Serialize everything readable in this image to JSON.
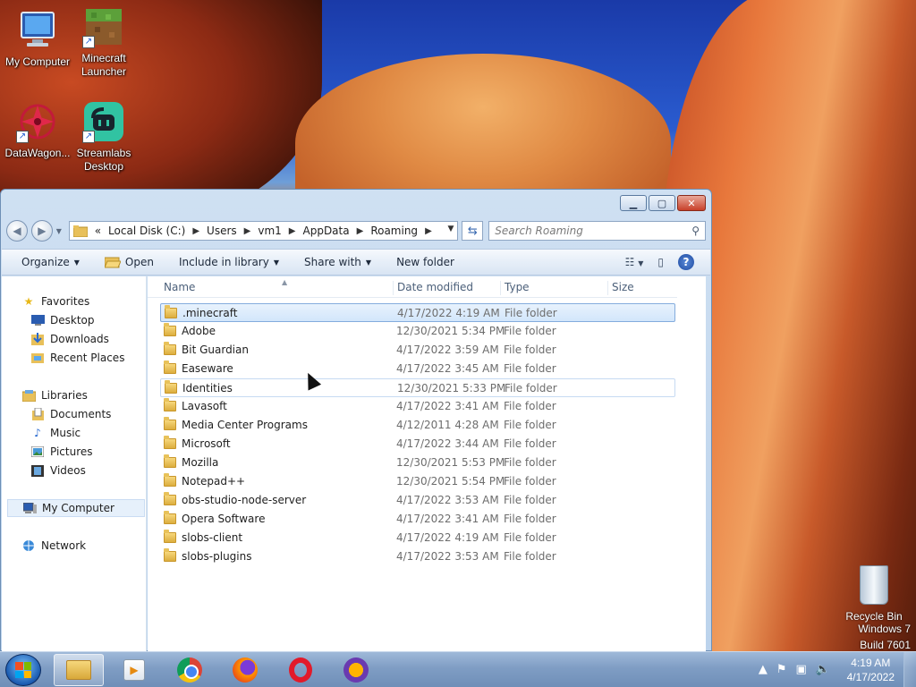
{
  "desktop": {
    "icons": [
      {
        "label": "My Computer",
        "icon": "computer-icon"
      },
      {
        "label": "Minecraft Launcher",
        "icon": "minecraft-icon"
      },
      {
        "label": "DataWagon...",
        "icon": "datawagon-icon"
      },
      {
        "label": "Streamlabs Desktop",
        "icon": "streamlabs-icon"
      }
    ],
    "recycle_bin": "Recycle Bin",
    "watermark": {
      "line1": "Windows 7",
      "line2": "Build 7601"
    }
  },
  "explorer": {
    "address": {
      "overflow": "«",
      "crumbs": [
        "Local Disk (C:)",
        "Users",
        "vm1",
        "AppData",
        "Roaming"
      ]
    },
    "search": {
      "placeholder": "Search Roaming"
    },
    "commands": {
      "organize": "Organize",
      "open": "Open",
      "include_in_library": "Include in library",
      "share_with": "Share with",
      "new_folder": "New folder"
    },
    "navigation": {
      "favorites": "Favorites",
      "desktop": "Desktop",
      "downloads": "Downloads",
      "recent_places": "Recent Places",
      "libraries": "Libraries",
      "documents": "Documents",
      "music": "Music",
      "pictures": "Pictures",
      "videos": "Videos",
      "my_computer": "My Computer",
      "network": "Network"
    },
    "columns": {
      "name": "Name",
      "date_modified": "Date modified",
      "type": "Type",
      "size": "Size"
    },
    "files": [
      {
        "name": ".minecraft",
        "date": "4/17/2022 4:19 AM",
        "type": "File folder"
      },
      {
        "name": "Adobe",
        "date": "12/30/2021 5:34 PM",
        "type": "File folder"
      },
      {
        "name": "Bit Guardian",
        "date": "4/17/2022 3:59 AM",
        "type": "File folder"
      },
      {
        "name": "Easeware",
        "date": "4/17/2022 3:45 AM",
        "type": "File folder"
      },
      {
        "name": "Identities",
        "date": "12/30/2021 5:33 PM",
        "type": "File folder"
      },
      {
        "name": "Lavasoft",
        "date": "4/17/2022 3:41 AM",
        "type": "File folder"
      },
      {
        "name": "Media Center Programs",
        "date": "4/12/2011 4:28 AM",
        "type": "File folder"
      },
      {
        "name": "Microsoft",
        "date": "4/17/2022 3:44 AM",
        "type": "File folder"
      },
      {
        "name": "Mozilla",
        "date": "12/30/2021 5:53 PM",
        "type": "File folder"
      },
      {
        "name": "Notepad++",
        "date": "12/30/2021 5:54 PM",
        "type": "File folder"
      },
      {
        "name": "obs-studio-node-server",
        "date": "4/17/2022 3:53 AM",
        "type": "File folder"
      },
      {
        "name": "Opera Software",
        "date": "4/17/2022 3:41 AM",
        "type": "File folder"
      },
      {
        "name": "slobs-client",
        "date": "4/17/2022 4:19 AM",
        "type": "File folder"
      },
      {
        "name": "slobs-plugins",
        "date": "4/17/2022 3:53 AM",
        "type": "File folder"
      }
    ]
  },
  "taskbar": {
    "clock": {
      "time": "4:19 AM",
      "date": "4/17/2022"
    }
  },
  "colors": {
    "selection_border": "#84acdd",
    "window_frame": "#bcd3ec",
    "taskbar": "#7f9dc4"
  }
}
